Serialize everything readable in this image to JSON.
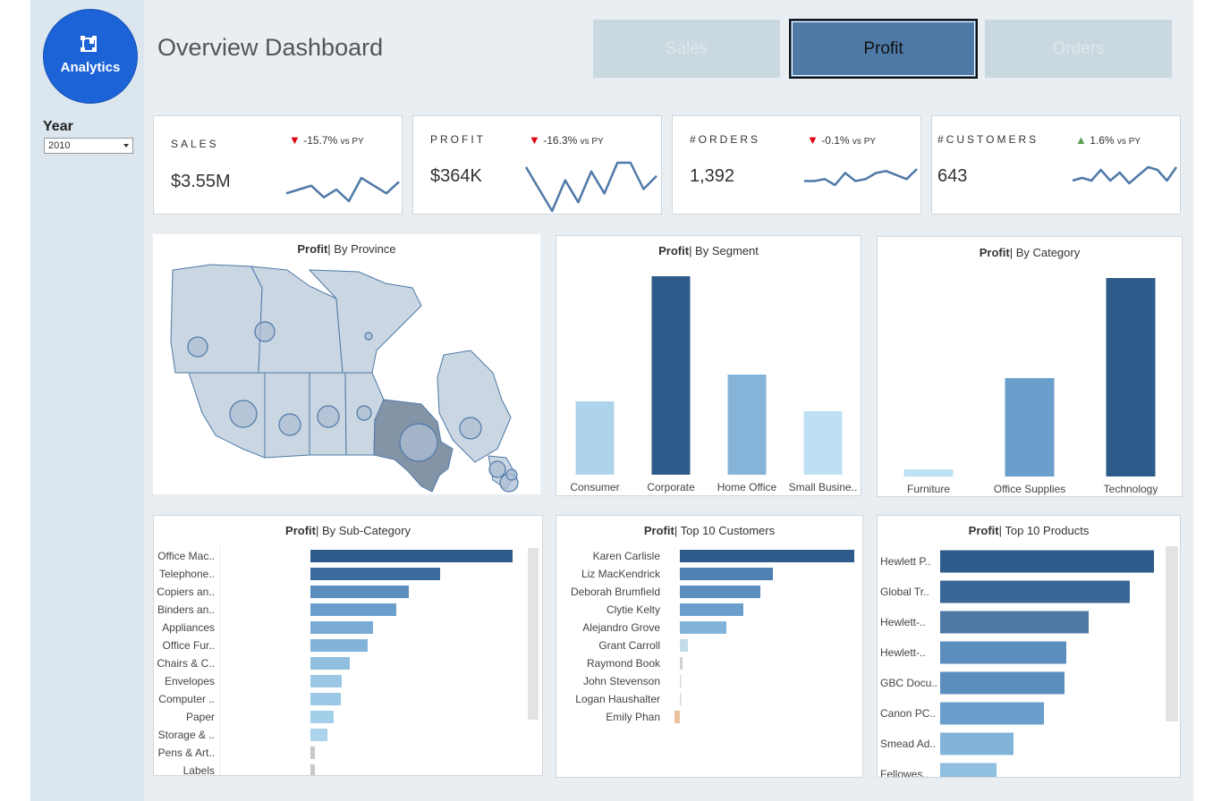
{
  "sidebar": {
    "logo_text": "Analytics",
    "year_label": "Year",
    "year_value": "2010"
  },
  "header": {
    "title": "Overview Dashboard",
    "tabs": [
      {
        "label": "Sales",
        "active": false
      },
      {
        "label": "Profit",
        "active": true
      },
      {
        "label": "Orders",
        "active": false
      }
    ]
  },
  "colors": {
    "primary": "#4e79a7",
    "dark": "#2f5b8a",
    "down": "#e0000f",
    "up": "#59a14f",
    "logo": "#1d63d8"
  },
  "kpis": [
    {
      "label": "SALES",
      "value": "$3.55M",
      "arrow": "▼",
      "change": "-15.7%",
      "suffix": "vs PY",
      "direction": "down",
      "spark": [
        11,
        12,
        13,
        10,
        12,
        9,
        15,
        13,
        11,
        14
      ]
    },
    {
      "label": "PROFIT",
      "value": "$364K",
      "arrow": "▼",
      "change": "-16.3%",
      "suffix": "vs PY",
      "direction": "down",
      "spark": [
        14,
        9,
        4,
        11,
        6,
        13,
        8,
        15,
        15,
        9,
        12
      ]
    },
    {
      "label": "#ORDERS",
      "value": "1,392",
      "arrow": "▼",
      "change": "-0.1%",
      "suffix": "vs PY",
      "direction": "down",
      "spark": [
        10,
        10,
        10.5,
        9,
        12,
        10,
        10.5,
        12,
        12.5,
        11.5,
        10.5,
        13
      ]
    },
    {
      "label": "#CUSTOMERS",
      "value": "643",
      "arrow": "▲",
      "change": "1.6%",
      "suffix": "vs PY",
      "direction": "up",
      "spark": [
        10,
        10.5,
        10,
        12,
        10,
        11.5,
        9.5,
        11,
        12.5,
        12,
        10,
        12.5
      ]
    }
  ],
  "panels": {
    "province": {
      "bold": "Profit",
      "rest": "| By Province"
    },
    "segment": {
      "bold": "Profit",
      "rest": "| By Segment"
    },
    "category": {
      "bold": "Profit",
      "rest": "| By Category"
    },
    "subcategory": {
      "bold": "Profit",
      "rest": "| By Sub-Category"
    },
    "customers": {
      "bold": "Profit",
      "rest": "| Top 10 Customers"
    },
    "products": {
      "bold": "Profit",
      "rest": "| Top 10 Products"
    }
  },
  "chart_data": [
    {
      "type": "bar",
      "id": "segment",
      "categories": [
        "Consumer",
        "Corporate",
        "Home Office",
        "Small Busine.."
      ],
      "values": [
        82,
        222,
        112,
        71
      ],
      "colors": [
        "#aed3ed",
        "#2f5b8a",
        "#86b4d8",
        "#bde0f3"
      ]
    },
    {
      "type": "bar",
      "id": "category",
      "categories": [
        "Furniture",
        "Office Supplies",
        "Technology"
      ],
      "values": [
        8,
        110,
        222
      ],
      "colors": [
        "#bde0f3",
        "#6b9fcb",
        "#2f5b8a"
      ]
    },
    {
      "type": "bar",
      "orientation": "horizontal",
      "id": "subcategory",
      "categories": [
        "Office Mac..",
        "Telephone..",
        "Copiers an..",
        "Binders an..",
        "Appliances",
        "Office Fur..",
        "Chairs & C..",
        "Envelopes",
        "Computer ..",
        "Paper",
        "Storage & ..",
        "Pens & Art..",
        "Labels"
      ],
      "values": [
        226,
        145,
        110,
        96,
        70,
        64,
        44,
        35,
        34,
        26,
        19,
        5,
        5
      ],
      "colors": [
        "#2f5b8a",
        "#3b6b9c",
        "#5b8dbd",
        "#6b9fcb",
        "#7aabd4",
        "#82b3d9",
        "#90bfe0",
        "#9ac8e5",
        "#9ac8e5",
        "#a4cfe9",
        "#abd4ec",
        "#c8c8c8",
        "#c8c8c8"
      ]
    },
    {
      "type": "bar",
      "orientation": "horizontal",
      "id": "customers",
      "categories": [
        "Karen Carlisle",
        "Liz MacKendrick",
        "Deborah Brumfield",
        "Clytie Kelty",
        "Alejandro Grove",
        "Grant Carroll",
        "Raymond Book",
        "John Stevenson",
        "Logan Haushalter",
        "Emily Phan"
      ],
      "values": [
        195,
        104,
        90,
        71,
        52,
        9,
        3,
        1,
        1,
        -6
      ],
      "colors": [
        "#2f5b8a",
        "#4f80b3",
        "#5b8dbd",
        "#6b9fcb",
        "#82b3d9",
        "#c2dcec",
        "#d2d2d2",
        "#d9d9d9",
        "#d9d9d9",
        "#e8c39e"
      ]
    },
    {
      "type": "bar",
      "orientation": "horizontal",
      "id": "products",
      "categories": [
        "Hewlett P..",
        "Global Tr..",
        "Hewlett-..",
        "Hewlett-..",
        "GBC Docu..",
        "Canon PC..",
        "Smead Ad..",
        "Fellowes.."
      ],
      "values": [
        239,
        212,
        166,
        141,
        139,
        116,
        82,
        63
      ],
      "colors": [
        "#2f5b8a",
        "#3a6798",
        "#4e79a7",
        "#5b8dbd",
        "#5b8dbd",
        "#6b9fcb",
        "#82b3d9",
        "#90bfe0"
      ]
    }
  ]
}
